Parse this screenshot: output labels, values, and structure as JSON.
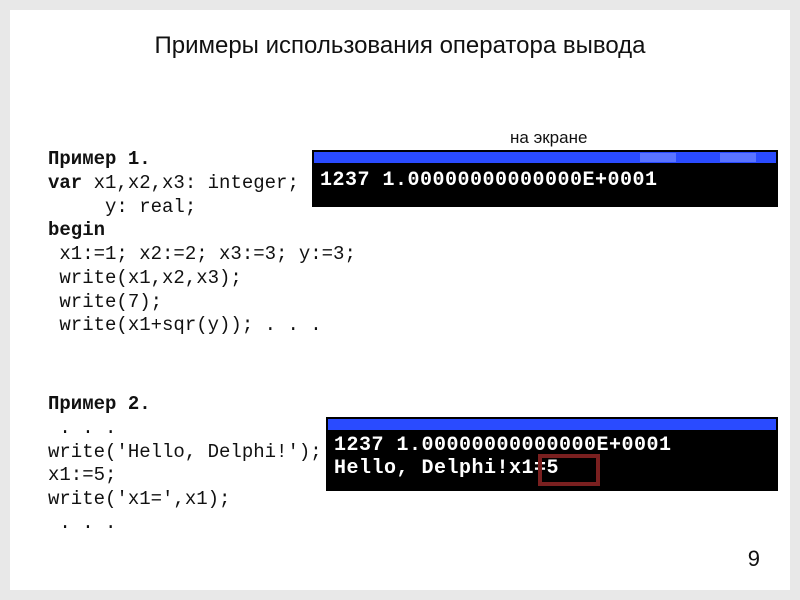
{
  "title": "Примеры использования оператора вывода",
  "screen_label": "на экране",
  "example1": {
    "header": "Пример 1.",
    "var_kw": "var",
    "var_decl1": " x1,x2,x3: integer;",
    "var_decl2": "     y: real;",
    "begin_kw": "begin",
    "line1": " x1:=1; x2:=2; x3:=3; y:=3;",
    "line2": " write(x1,x2,x3);",
    "line3": " write(7);",
    "line4": " write(x1+sqr(y)); . . ."
  },
  "console1_output": "1237 1.00000000000000E+0001",
  "example2": {
    "header": "Пример 2.",
    "line1": " . . .",
    "line2": "write('Hello, Delphi!');",
    "line3": "x1:=5;",
    "line4": "write('x1=',x1);",
    "line5": " . . ."
  },
  "console2_line1": "1237 1.00000000000000E+0001",
  "console2_line2": "Hello, Delphi!x1=5",
  "slide_number": "9"
}
